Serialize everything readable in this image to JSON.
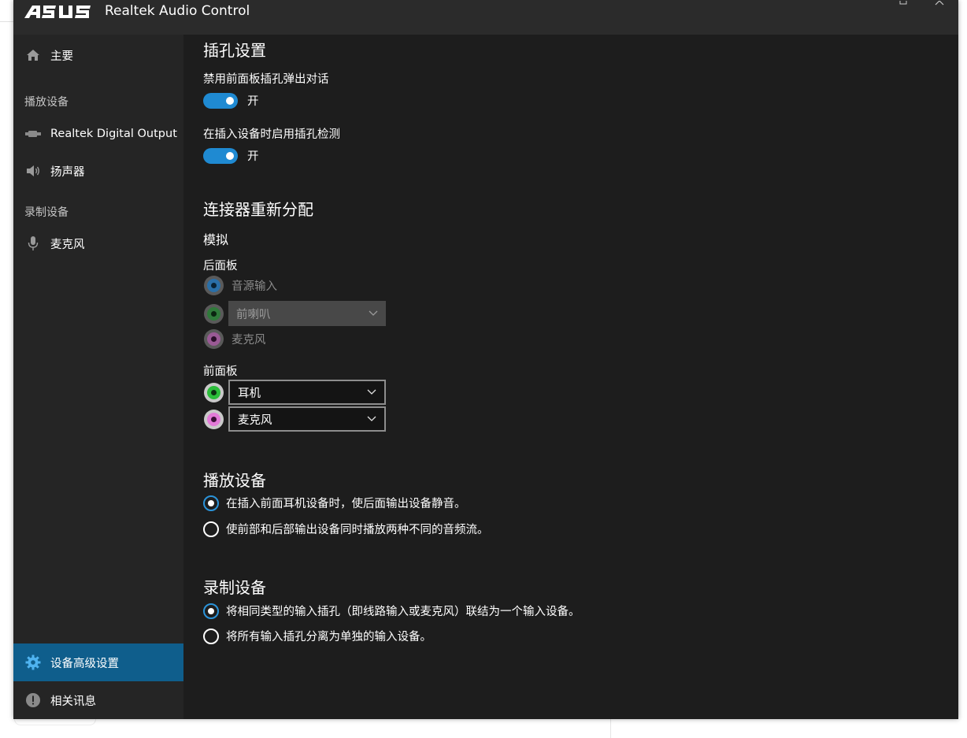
{
  "app": {
    "logo_text": "ASUS",
    "title": "Realtek Audio Control"
  },
  "sidebar": {
    "items": [
      {
        "label": "主要",
        "icon": "home-icon"
      },
      {
        "label": "Realtek Digital Output",
        "icon": "digital-output-icon"
      },
      {
        "label": "扬声器",
        "icon": "speaker-icon"
      },
      {
        "label": "麦克风",
        "icon": "microphone-icon"
      },
      {
        "label": "设备高级设置",
        "icon": "gear-icon"
      },
      {
        "label": "相关讯息",
        "icon": "info-icon"
      }
    ],
    "sections": {
      "playback": "播放设备",
      "recording": "录制设备"
    },
    "active_color": "#0f5e8c"
  },
  "main": {
    "jack_settings": {
      "heading": "插孔设置",
      "disable_popup_label": "禁用前面板插孔弹出对话",
      "disable_popup_state": "开",
      "jack_detect_label": "在插入设备时启用插孔检测",
      "jack_detect_state": "开"
    },
    "connector_reassign": {
      "heading": "连接器重新分配",
      "analog_label": "模拟",
      "rear_panel_label": "后面板",
      "rear_jacks": [
        {
          "label": "音源输入",
          "color": "#2a6fa8"
        },
        {
          "selected": "前喇叭",
          "color": "#2f7a3a"
        },
        {
          "label": "麦克风",
          "color": "#9a5a95"
        }
      ],
      "front_panel_label": "前面板",
      "front_jacks": [
        {
          "selected": "耳机",
          "color": "#2bbd3a"
        },
        {
          "selected": "麦克风",
          "color": "#e37ad8"
        }
      ]
    },
    "playback": {
      "heading": "播放设备",
      "options": [
        {
          "label": "在插入前面耳机设备时，使后面输出设备静音。",
          "checked": true
        },
        {
          "label": "使前部和后部输出设备同时播放两种不同的音频流。",
          "checked": false
        }
      ]
    },
    "recording": {
      "heading": "录制设备",
      "options": [
        {
          "label": "将相同类型的输入插孔（即线路输入或麦克风）联结为一个输入设备。",
          "checked": true
        },
        {
          "label": "将所有输入插孔分离为单独的输入设备。",
          "checked": false
        }
      ]
    }
  },
  "colors": {
    "window_bg": "#1d1d1d",
    "sidebar_bg": "#252525",
    "titlebar_bg": "#2b2b2b",
    "toggle_on": "#1f8ad2",
    "radio_accent": "#2b93d9"
  }
}
